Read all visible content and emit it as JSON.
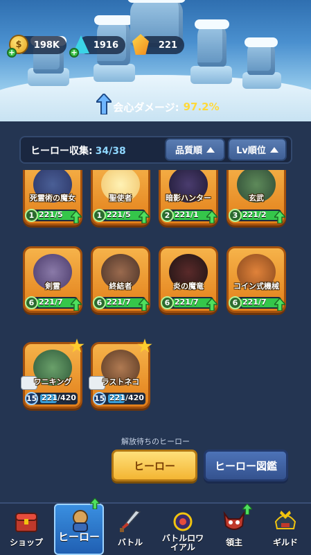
{
  "currency": {
    "gold": "198K",
    "gems": "1916",
    "crystals": "221",
    "gold_icon": "gold-coin-icon",
    "gem_icon": "blue-gem-icon",
    "crystal_icon": "orange-crystal-icon"
  },
  "crit": {
    "label": "会心ダメージ:",
    "value": "97.2%"
  },
  "collection": {
    "label": "ヒーロー収集:",
    "count": "34/38",
    "sort_quality": "品質順",
    "sort_level": "Lv順位"
  },
  "heroes": [
    {
      "name": "死霊術の魔女",
      "level": "1",
      "progress": "221/5"
    },
    {
      "name": "聖使者",
      "level": "1",
      "progress": "221/5"
    },
    {
      "name": "暗影ハンター",
      "level": "2",
      "progress": "221/1"
    },
    {
      "name": "玄武",
      "level": "3",
      "progress": "221/2"
    },
    {
      "name": "剣霊",
      "level": "6",
      "progress": "221/7"
    },
    {
      "name": "終結者",
      "level": "6",
      "progress": "221/7"
    },
    {
      "name": "炎の魔竜",
      "level": "6",
      "progress": "221/7"
    },
    {
      "name": "コイン式機械",
      "level": "6",
      "progress": "221/7"
    },
    {
      "name": "ワニキング",
      "level": "15",
      "progress": "221/420"
    },
    {
      "name": "ラストネコ",
      "level": "15",
      "progress": "221/420"
    }
  ],
  "unreleased_label": "解放待ちのヒーロー",
  "buttons": {
    "hero": "ヒーロー",
    "dex": "ヒーロー図鑑"
  },
  "nav": {
    "shop": "ショップ",
    "hero": "ヒーロー",
    "battle": "バトル",
    "battle_royale": "バトルロワイアル",
    "lord": "領主",
    "guild": "ギルド"
  },
  "colors": {
    "accent_gold": "#ffd93b",
    "card_orange": "#e27f1a",
    "panel_bg": "#243552",
    "nav_active": "#3a8fe0"
  }
}
